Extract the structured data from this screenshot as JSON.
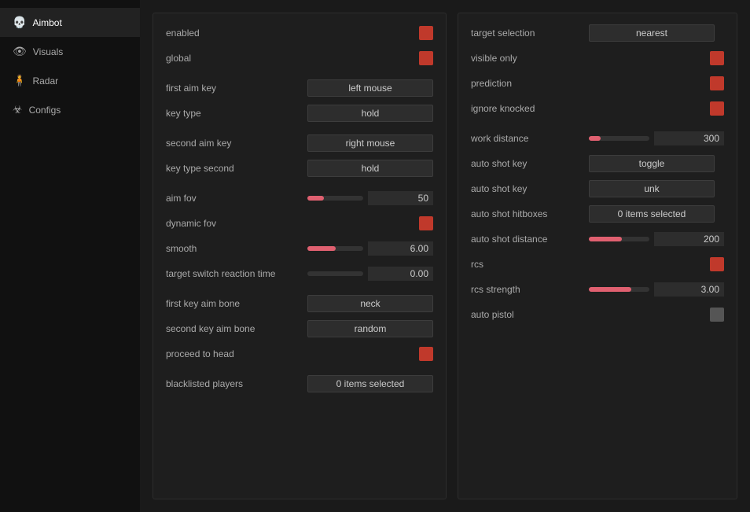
{
  "sidebar": {
    "items": [
      {
        "id": "aimbot",
        "label": "Aimbot",
        "icon": "💀",
        "active": true
      },
      {
        "id": "visuals",
        "label": "Visuals",
        "icon": "👁",
        "active": false
      },
      {
        "id": "radar",
        "label": "Radar",
        "icon": "🧍",
        "active": false
      },
      {
        "id": "configs",
        "label": "Configs",
        "icon": "☣",
        "active": false
      }
    ]
  },
  "left_panel": {
    "rows": [
      {
        "id": "enabled",
        "label": "enabled",
        "control": "toggle_red"
      },
      {
        "id": "global",
        "label": "global",
        "control": "toggle_red"
      },
      {
        "id": "first_aim_key",
        "label": "first aim key",
        "value": "left mouse"
      },
      {
        "id": "key_type",
        "label": "key type",
        "value": "hold"
      },
      {
        "id": "second_aim_key",
        "label": "second aim key",
        "value": "right mouse"
      },
      {
        "id": "key_type_second",
        "label": "key type second",
        "value": "hold"
      },
      {
        "id": "aim_fov",
        "label": "aim fov",
        "slider_value": "50",
        "fill_pct": 30
      },
      {
        "id": "dynamic_fov",
        "label": "dynamic fov",
        "control": "toggle_red"
      },
      {
        "id": "smooth",
        "label": "smooth",
        "slider_value": "6.00",
        "fill_pct": 50
      },
      {
        "id": "target_switch",
        "label": "target switch reaction time",
        "slider_value": "0.00",
        "fill_pct": 0
      },
      {
        "id": "first_key_aim_bone",
        "label": "first key aim bone",
        "value": "neck"
      },
      {
        "id": "second_key_aim_bone",
        "label": "second key aim bone",
        "value": "random"
      },
      {
        "id": "proceed_to_head",
        "label": "proceed to head",
        "control": "toggle_red"
      },
      {
        "id": "blacklisted_players",
        "label": "blacklisted players",
        "value": "0 items selected"
      }
    ]
  },
  "right_panel": {
    "rows": [
      {
        "id": "target_selection",
        "label": "target selection",
        "value": "nearest"
      },
      {
        "id": "visible_only",
        "label": "visible only",
        "control": "toggle_red"
      },
      {
        "id": "prediction",
        "label": "prediction",
        "control": "toggle_red"
      },
      {
        "id": "ignore_knocked",
        "label": "ignore knocked",
        "control": "toggle_red"
      },
      {
        "id": "work_distance",
        "label": "work distance",
        "slider_value": "300",
        "fill_pct": 20
      },
      {
        "id": "auto_shot_key",
        "label": "auto shot key",
        "value": "toggle"
      },
      {
        "id": "auto_shot_key2",
        "label": "auto shot key",
        "value": "unk"
      },
      {
        "id": "auto_shot_hitboxes",
        "label": "auto shot hitboxes",
        "value": "0 items selected"
      },
      {
        "id": "auto_shot_distance",
        "label": "auto shot distance",
        "slider_value": "200",
        "fill_pct": 55
      },
      {
        "id": "rcs",
        "label": "rcs",
        "control": "toggle_red"
      },
      {
        "id": "rcs_strength",
        "label": "rcs strength",
        "slider_value": "3.00",
        "fill_pct": 70
      },
      {
        "id": "auto_pistol",
        "label": "auto pistol",
        "control": "toggle_gray"
      }
    ]
  }
}
